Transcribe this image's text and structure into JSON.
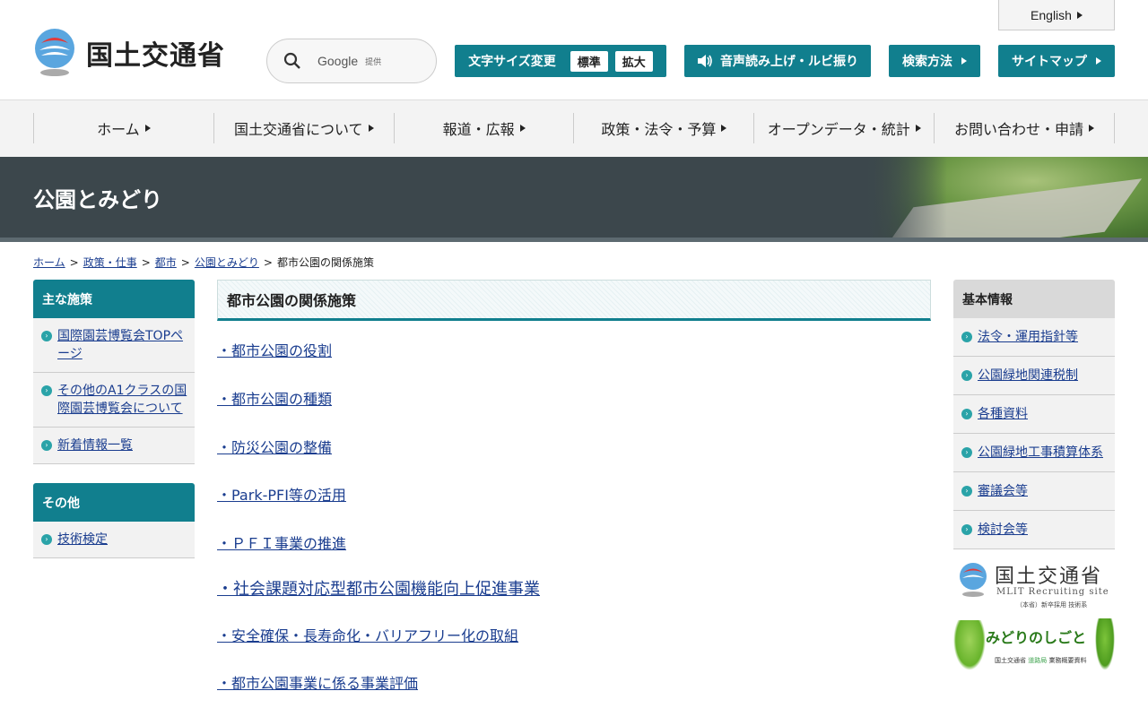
{
  "header": {
    "logo_text": "国土交通省",
    "search": {
      "provider": "Google",
      "provider_suffix": "提供"
    },
    "english_label": "English",
    "text_size": {
      "label": "文字サイズ変更",
      "standard": "標準",
      "large": "拡大"
    },
    "read_aloud_label": "音声読み上げ・ルビ振り",
    "search_method_label": "検索方法",
    "sitemap_label": "サイトマップ"
  },
  "global_nav": [
    {
      "label": "ホーム"
    },
    {
      "label": "国土交通省について"
    },
    {
      "label": "報道・広報"
    },
    {
      "label": "政策・法令・予算"
    },
    {
      "label": "オープンデータ・統計"
    },
    {
      "label": "お問い合わせ・申請"
    }
  ],
  "banner": {
    "title": "公園とみどり"
  },
  "breadcrumb": {
    "items": [
      "ホーム",
      "政策・仕事",
      "都市",
      "公園とみどり"
    ],
    "current": "都市公園の関係施策",
    "separator": ">"
  },
  "left_sidebar": {
    "main_policies": {
      "title": "主な施策",
      "items": [
        {
          "label": "国際園芸博覧会TOPページ"
        },
        {
          "label": "その他のA1クラスの国際園芸博覧会について"
        },
        {
          "label": "新着情報一覧"
        }
      ]
    },
    "others": {
      "title": "その他",
      "items": [
        {
          "label": "技術検定"
        }
      ]
    }
  },
  "main": {
    "title": "都市公園の関係施策",
    "links": [
      {
        "label": "・都市公園の役割"
      },
      {
        "label": "・都市公園の種類"
      },
      {
        "label": "・防災公園の整備"
      },
      {
        "label": "・Park-PFI等の活用"
      },
      {
        "label": "・ＰＦＩ事業の推進"
      },
      {
        "label": "・社会課題対応型都市公園機能向上促進事業"
      },
      {
        "label": "・安全確保・長寿命化・バリアフリー化の取組"
      },
      {
        "label": "・都市公園事業に係る事業評価"
      }
    ]
  },
  "right_sidebar": {
    "title": "基本情報",
    "items": [
      {
        "label": "法令・運用指針等"
      },
      {
        "label": "公園緑地関連税制"
      },
      {
        "label": "各種資料"
      },
      {
        "label": "公園緑地工事積算体系"
      },
      {
        "label": "審議会等"
      },
      {
        "label": "検討会等"
      }
    ]
  },
  "banners": {
    "recruit": {
      "title": "国土交通省",
      "sub": "MLIT Recruiting site",
      "note": "（本省）新卒採用 技術系"
    },
    "midori": {
      "title": "みどりのしごと",
      "sub_prefix": "国土交通省",
      "sub_highlight": "道路局",
      "sub_suffix": "業務概要資料"
    }
  },
  "colors": {
    "accent": "#117f8e",
    "banner_bg": "#3c474c",
    "link": "#1a3d8f"
  }
}
